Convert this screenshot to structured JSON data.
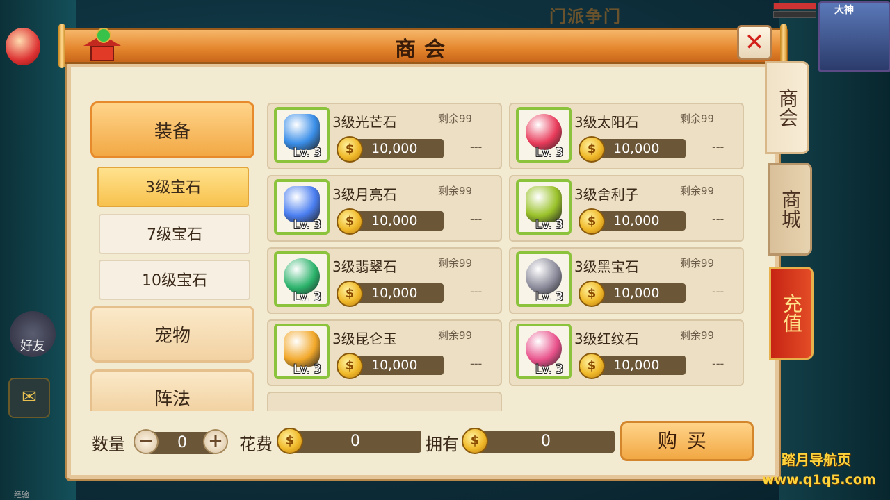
{
  "background": {
    "top_title": "门派争门",
    "player_name": "大神",
    "friends_label": "好友",
    "exp_label": "经验"
  },
  "watermark": {
    "line1": "踏月导航页",
    "line2": "www.q1q5.com"
  },
  "panel": {
    "title": "商会"
  },
  "categories": {
    "equip": "装备",
    "sub": [
      "3级宝石",
      "7级宝石",
      "10级宝石"
    ],
    "pet": "宠物",
    "formation": "阵法"
  },
  "items": [
    {
      "name": "3级光芒石",
      "remain": "剩余99",
      "price": "10,000",
      "lv": "Lv. 3",
      "owned": "---",
      "gem": "crystal-blue-icon",
      "color": "#3a8ee8"
    },
    {
      "name": "3级太阳石",
      "remain": "剩余99",
      "price": "10,000",
      "lv": "Lv. 3",
      "owned": "---",
      "gem": "swirl-red-icon",
      "color": "#e83a5a"
    },
    {
      "name": "3级月亮石",
      "remain": "剩余99",
      "price": "10,000",
      "lv": "Lv. 3",
      "owned": "---",
      "gem": "crescent-blue-icon",
      "color": "#4a7ef0"
    },
    {
      "name": "3级舍利子",
      "remain": "剩余99",
      "price": "10,000",
      "lv": "Lv. 3",
      "owned": "---",
      "gem": "green-beads-icon",
      "color": "#9ac22a"
    },
    {
      "name": "3级翡翠石",
      "remain": "剩余99",
      "price": "10,000",
      "lv": "Lv. 3",
      "owned": "---",
      "gem": "jade-orb-icon",
      "color": "#2ab26a"
    },
    {
      "name": "3级黑宝石",
      "remain": "剩余99",
      "price": "10,000",
      "lv": "Lv. 3",
      "owned": "---",
      "gem": "black-diamond-icon",
      "color": "#8a8a9a"
    },
    {
      "name": "3级昆仑玉",
      "remain": "剩余99",
      "price": "10,000",
      "lv": "Lv. 3",
      "owned": "---",
      "gem": "amber-jade-icon",
      "color": "#f2a82a"
    },
    {
      "name": "3级红纹石",
      "remain": "剩余99",
      "price": "10,000",
      "lv": "Lv. 3",
      "owned": "---",
      "gem": "pink-swirl-icon",
      "color": "#e8508a"
    }
  ],
  "bottom": {
    "qty_label": "数量",
    "qty_value": "0",
    "cost_label": "花费",
    "cost_value": "0",
    "owned_label": "拥有",
    "owned_value": "0",
    "buy_label": "购买",
    "coin_char": "$"
  },
  "side_tabs": [
    "商会",
    "商城",
    "充值"
  ]
}
